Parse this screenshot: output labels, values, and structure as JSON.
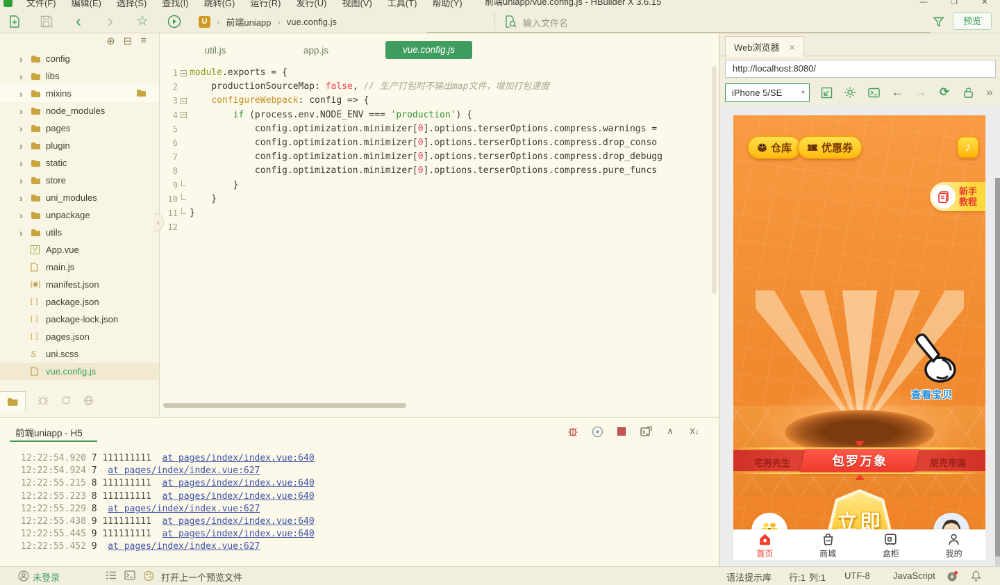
{
  "window": {
    "title": "前端uniapp/vue.config.js - HBuilder X 3.6.15"
  },
  "menubar": {
    "items": [
      "文件(F)",
      "编辑(E)",
      "选择(S)",
      "查找(I)",
      "跳转(G)",
      "运行(R)",
      "发行(U)",
      "视图(V)",
      "工具(T)",
      "帮助(Y)"
    ]
  },
  "toolbar": {
    "breadcrumb_project": "前端uniapp",
    "breadcrumb_file": "vue.config.js",
    "breadcrumb_logo": "U",
    "search_placeholder": "输入文件名",
    "preview_button": "预览"
  },
  "icons": {
    "back": "‹",
    "forward": "›",
    "star": "☆",
    "breadcrumb_sep": "›",
    "sidebar_locate": "⊕",
    "sidebar_collapse": "⊟",
    "sidebar_menu": "≡",
    "splitter_collapse": "‹",
    "win_min": "—",
    "win_max": "❐",
    "win_close": "✕",
    "tab_close": "×",
    "caret_down": "▾",
    "arrow_left": "←",
    "arrow_right": "→",
    "refresh": "⟳",
    "more": "»",
    "music": "♪",
    "collapse_up": "∧",
    "clear_logs": "X↓",
    "file_vue": "V",
    "file_manifest": "[◉]",
    "file_json": "[ ]",
    "file_scss": "S"
  },
  "sidebar": {
    "items": [
      {
        "label": "config",
        "type": "folder"
      },
      {
        "label": "libs",
        "type": "folder"
      },
      {
        "label": "mixins",
        "type": "folder",
        "hover": true
      },
      {
        "label": "node_modules",
        "type": "folder"
      },
      {
        "label": "pages",
        "type": "folder"
      },
      {
        "label": "plugin",
        "type": "folder"
      },
      {
        "label": "static",
        "type": "folder"
      },
      {
        "label": "store",
        "type": "folder"
      },
      {
        "label": "uni_modules",
        "type": "folder"
      },
      {
        "label": "unpackage",
        "type": "folder"
      },
      {
        "label": "utils",
        "type": "folder"
      },
      {
        "label": "App.vue",
        "type": "file",
        "icon": "vue"
      },
      {
        "label": "main.js",
        "type": "file",
        "icon": "js"
      },
      {
        "label": "manifest.json",
        "type": "file",
        "icon": "manifest"
      },
      {
        "label": "package.json",
        "type": "file",
        "icon": "json"
      },
      {
        "label": "package-lock.json",
        "type": "file",
        "icon": "json"
      },
      {
        "label": "pages.json",
        "type": "file",
        "icon": "json"
      },
      {
        "label": "uni.scss",
        "type": "file",
        "icon": "scss"
      },
      {
        "label": "vue.config.js",
        "type": "file",
        "icon": "js",
        "selected": true
      }
    ]
  },
  "editor": {
    "tabs": [
      {
        "label": "util.js"
      },
      {
        "label": "app.js"
      },
      {
        "label": "vue.config.js",
        "active": true
      }
    ],
    "lines": [
      {
        "n": "1",
        "fold": "open",
        "tokens": [
          [
            "module",
            "builtin"
          ],
          [
            ".exports = {",
            "plain"
          ]
        ]
      },
      {
        "n": "2",
        "tokens": [
          [
            "    productionSourceMap: ",
            "plain"
          ],
          [
            "false",
            "bool"
          ],
          [
            ", ",
            "plain"
          ],
          [
            "// 生产打包时不输出map文件，增加打包速度",
            "comment"
          ]
        ]
      },
      {
        "n": "3",
        "fold": "open",
        "tokens": [
          [
            "    configureWebpack",
            "prop"
          ],
          [
            ": config => {",
            "plain"
          ]
        ]
      },
      {
        "n": "4",
        "fold": "open",
        "tokens": [
          [
            "        ",
            "plain"
          ],
          [
            "if",
            "kw"
          ],
          [
            " (process.env.NODE_ENV === ",
            "plain"
          ],
          [
            "'production'",
            "str"
          ],
          [
            ") {",
            "plain"
          ]
        ]
      },
      {
        "n": "5",
        "tokens": [
          [
            "            config.optimization.minimizer[",
            "plain"
          ],
          [
            "0",
            "num"
          ],
          [
            "].options.terserOptions.compress.warnings =",
            "plain"
          ]
        ]
      },
      {
        "n": "6",
        "tokens": [
          [
            "            config.optimization.minimizer[",
            "plain"
          ],
          [
            "0",
            "num"
          ],
          [
            "].options.terserOptions.compress.drop_conso",
            "plain"
          ]
        ]
      },
      {
        "n": "7",
        "tokens": [
          [
            "            config.optimization.minimizer[",
            "plain"
          ],
          [
            "0",
            "num"
          ],
          [
            "].options.terserOptions.compress.drop_debugg",
            "plain"
          ]
        ]
      },
      {
        "n": "8",
        "tokens": [
          [
            "            config.optimization.minimizer[",
            "plain"
          ],
          [
            "0",
            "num"
          ],
          [
            "].options.terserOptions.compress.pure_funcs",
            "plain"
          ]
        ]
      },
      {
        "n": "9",
        "fold": "end",
        "tokens": [
          [
            "        }",
            "plain"
          ]
        ]
      },
      {
        "n": "10",
        "fold": "end",
        "tokens": [
          [
            "    }",
            "plain"
          ]
        ]
      },
      {
        "n": "11",
        "fold": "end",
        "tokens": [
          [
            "}",
            "plain"
          ]
        ]
      },
      {
        "n": "12",
        "tokens": []
      }
    ]
  },
  "console": {
    "tab": "前端uniapp - H5",
    "logs": [
      {
        "time": "12:22:54.920",
        "count": "7",
        "msg": "111111111",
        "link": "at pages/index/index.vue:640"
      },
      {
        "time": "12:22:54.924",
        "count": "7",
        "msg": "",
        "link": "at pages/index/index.vue:627"
      },
      {
        "time": "12:22:55.215",
        "count": "8",
        "msg": "111111111",
        "link": "at pages/index/index.vue:640"
      },
      {
        "time": "12:22:55.223",
        "count": "8",
        "msg": "111111111",
        "link": "at pages/index/index.vue:640"
      },
      {
        "time": "12:22:55.229",
        "count": "8",
        "msg": "",
        "link": "at pages/index/index.vue:627"
      },
      {
        "time": "12:22:55.438",
        "count": "9",
        "msg": "111111111",
        "link": "at pages/index/index.vue:640"
      },
      {
        "time": "12:22:55.445",
        "count": "9",
        "msg": "111111111",
        "link": "at pages/index/index.vue:640"
      },
      {
        "time": "12:22:55.452",
        "count": "9",
        "msg": "",
        "link": "at pages/index/index.vue:627"
      }
    ]
  },
  "browser": {
    "tab": "Web浏览器",
    "url": "http://localhost:8080/",
    "device": "iPhone 5/SE"
  },
  "app": {
    "warehouse": "仓库",
    "coupon": "优惠券",
    "tutorial_line1": "新手",
    "tutorial_line2": "教程",
    "view_treasure": "查看宝贝",
    "carousel": [
      {
        "label": "宅男先生"
      },
      {
        "label": "包罗万象",
        "active": true
      },
      {
        "label": "朋克帝国"
      }
    ],
    "cta": "立即",
    "tabbar": [
      {
        "label": "首页",
        "active": true
      },
      {
        "label": "商城"
      },
      {
        "label": "盒柜"
      },
      {
        "label": "我的"
      }
    ]
  },
  "statusbar": {
    "login": "未登录",
    "open_prev": "打开上一个预览文件",
    "syntax_lib": "语法提示库",
    "line": "行:1",
    "col": "列:1",
    "encoding": "UTF-8",
    "language": "JavaScript"
  },
  "colors": {
    "accent_green": "#3f9e5f",
    "console_link": "#3d52a8",
    "phone_orange": "#f28c31",
    "cta_gold": "#ffcd3e",
    "tabbar_active_red": "#f23d2c",
    "banner_red": "#e14437",
    "button_yellow": "#ffd83e"
  }
}
